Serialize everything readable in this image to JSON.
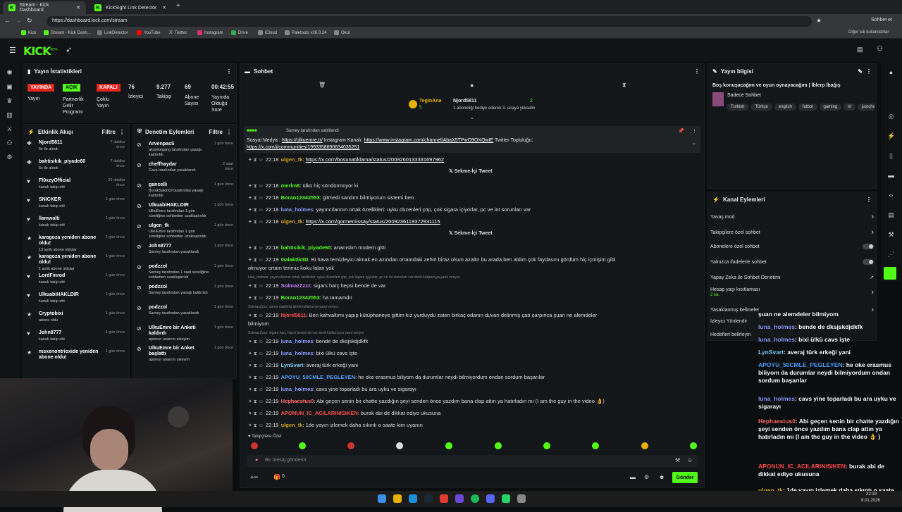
{
  "browser": {
    "tabs": [
      {
        "title": "Stream - Kick Dashboard"
      },
      {
        "title": "KickSight Link Detector"
      }
    ],
    "url": "https://dashboard.kick.com/stream",
    "profile": "Sohbet et",
    "bookmarks": [
      "Kick",
      "Stream - Kick Dash...",
      "LinkDetector",
      "YouTube",
      "Twitter",
      "Instagram",
      "Drive",
      "iCloud",
      "Paletools v26.0.24",
      "Okul"
    ],
    "other_bookmarks": "Diğer sık kullanılanlar"
  },
  "kick": {
    "logo": "KICK",
    "logo_sup": "BETA"
  },
  "stats": {
    "title": "Yayın İstatistikleri",
    "live_badge": "YAYINDA",
    "open_badge": "AÇIK",
    "closed_badge": "KAPALI",
    "live_label": "Yayın",
    "partner_label": "Partnerlik Gelir Programı",
    "multi_label": "Çoklu Yayın",
    "viewers": "76",
    "viewers_label": "İzleyici",
    "followers": "9.277",
    "followers_label": "Takipçi",
    "subs": "69",
    "subs_label": "Abone Sayısı",
    "uptime": "00:42:55",
    "uptime_label": "Yayında Olduğu Süre"
  },
  "activity": {
    "title": "Etkinlik Akışı",
    "filter": "Filtre",
    "items": [
      {
        "name": "Njord5811",
        "detail": "5x ile alındı",
        "time": "7 dakika önce",
        "icon": "✚"
      },
      {
        "name": "bahtisikik_piyade60",
        "detail": "5x ile alındı",
        "time": "7 dakika önce",
        "icon": "✚"
      },
      {
        "name": "Fl0xzyOfficial",
        "detail": "kanalı takip etti",
        "time": "29 dakika önce",
        "icon": "♥"
      },
      {
        "name": "SNICKER",
        "detail": "kanalı takip etti",
        "time": "1 gün önce",
        "icon": "♥"
      },
      {
        "name": "llamwalti",
        "detail": "kanalı takip etti",
        "time": "1 gün önce",
        "icon": "♥"
      },
      {
        "name": "karagoza yeniden abone oldu!",
        "detail": "13 aylık abone oldular",
        "time": "1 gün önce",
        "icon": "★"
      },
      {
        "name": "karagoza yeniden abone oldu!",
        "detail": "1 aylık abone oldular",
        "time": "1 gün önce",
        "icon": "★"
      },
      {
        "name": "LordFinrod",
        "detail": "kanalı takip etti",
        "time": "1 gün önce",
        "icon": "♥"
      },
      {
        "name": "UlkuabiHAKLDIR",
        "detail": "kanalı takip etti",
        "time": "1 gün önce",
        "icon": "♥"
      },
      {
        "name": "Cryptobixi",
        "detail": "abone oldu",
        "time": "1 gün önce",
        "icon": "★"
      },
      {
        "name": "John8777",
        "detail": "kanalı takip etti",
        "time": "1 gün önce",
        "icon": "♥"
      },
      {
        "name": "msxenontrioxide yeniden abone oldu!",
        "detail": "",
        "time": "1 gün önce",
        "icon": "★"
      }
    ]
  },
  "moderation": {
    "title": "Denetim Eylemleri",
    "filter": "Filtre",
    "items": [
      {
        "name": "ArvenpasS",
        "detail": "alosekegang tarafından yasağı kaldırıldı",
        "time": "1 gün önce"
      },
      {
        "name": "cheffhaydar",
        "detail": "Cavs tarafından yasaklandı",
        "time": "2 saat önce"
      },
      {
        "name": "gancelli",
        "detail": "BurakSakinOl tarafından yasağı kaldırıldı",
        "time": "1 gün önce"
      },
      {
        "name": "UlkuabiHAKLDIR",
        "detail": "UlkuEmre tarafından 1 gün süreliğine sohbetten uzaklaştırıldı",
        "time": "1 gün önce"
      },
      {
        "name": "ulgen_tk",
        "detail": "UlkuEmre tarafından 1 gün süreliğine sohbetten uzaklaştırıldı",
        "time": "1 gün önce"
      },
      {
        "name": "John8777",
        "detail": "Sarney tarafından yasaklandı",
        "time": "1 gün önce"
      },
      {
        "name": "podzzol",
        "detail": "Sarney tarafından 1 saat süreliğine sohbetten uzaklaştırıldı",
        "time": "1 gün önce"
      },
      {
        "name": "podzzol",
        "detail": "Sarney tarafından yasağı kaldırıldı",
        "time": "1 gün önce"
      },
      {
        "name": "podzzol",
        "detail": "Sarney tarafından yasaklandı",
        "time": "1 gün önce"
      },
      {
        "name": "UlkuEmre bir Anketi kaldırdı",
        "detail": "aponun ananını sikeyim",
        "time": "1 gün önce"
      },
      {
        "name": "UlkuEmre bir Anket başlattı",
        "detail": "aponun ananını sikeyim",
        "time": "1 gün önce"
      }
    ]
  },
  "chat": {
    "title": "Sohbet",
    "top_user1": "TeginAna",
    "top_user1_sub": "5",
    "top_user2": "Njord5811",
    "top_user2_count": "2",
    "gift_text": "1 aboneliği hediye ederek 3. sıraya yükselin",
    "pinned_by": "Sarney tarafından sabitlendi",
    "pinned_text_a": "Sosyal Medya : ",
    "pinned_link1": "https://ulkuemre.tr/",
    "pinned_text_b": " Instagram Kanalı: ",
    "pinned_link2": "https://www.instagram.com/channel/AbaX5TPwO9OXQwIE",
    "pinned_text_c": " Twitter Topluluğu:",
    "pinned_link3": "https://x.com/i/communities/1993358890634035251",
    "embed_label": "Sekme-İçi Tweet",
    "messages": [
      {
        "time": "22:18",
        "user": "ulgen_tk",
        "color": "#d4a017",
        "text": "",
        "link": "https://x.com/bosunatiklama/status/2009260133331697962"
      },
      {
        "time": "22:18",
        "user": "merlm8",
        "color": "#53fc18",
        "text": "ülkü hiç söndürmüyor ki",
        "link": ""
      },
      {
        "time": "22:18",
        "user": "Boran12342553",
        "color": "#53fc18",
        "text": "gitmedi sandım bilmiyorum sistemi ben",
        "link": ""
      },
      {
        "time": "22:18",
        "user": "luna_holmes",
        "color": "#8a9cff",
        "text": "yayıncılarının ortak özellikleri: uyku düzenleri çöp, çok sigara içiyorlar, pc ve int sorunları var",
        "link": ""
      },
      {
        "time": "22:18",
        "user": "ulgen_tk",
        "color": "#d4a017",
        "text": "",
        "link": "https://x.com/gormemissay/status/2009236119372931115"
      },
      {
        "time": "22:18",
        "user": "bahtisikik_piyade60",
        "color": "#53fc18",
        "text": "ananıskm modem gitti",
        "link": ""
      },
      {
        "time": "22:19",
        "user": "Galaktik3D",
        "color": "#53fc18",
        "text": "Bi hava temizleyici almak en azından ortamdaki zehiri biraz olsun azaltır bu arada ben aldım çok faydasını gördüm hiç içmişim gibi",
        "link": ""
      },
      {
        "time": "",
        "user": "",
        "color": "",
        "text": "olmuyor ortam terimiz koku falan yok",
        "link": ""
      },
      {
        "time": "22:19",
        "user": "SolmazZzzz",
        "color": "#c77dff",
        "text": "sigars harç hepsi bende de var",
        "link": ""
      },
      {
        "time": "22:19",
        "user": "Boran12342553",
        "color": "#53fc18",
        "text": "ha tamamdır",
        "link": ""
      },
      {
        "time": "22:19",
        "user": "Njord5811",
        "color": "#ff4d4d",
        "text": "Ben kahvaltımı yapıp kütüphaneye gittim kız yurduydu zaten birkaç odanın duvarı delinmiş çatı çarpınca şuan ne alemdeler",
        "link": ""
      },
      {
        "time": "",
        "user": "",
        "color": "",
        "text": "bilmiyom",
        "link": ""
      },
      {
        "time": "22:19",
        "user": "luna_holmes",
        "color": "#8a9cff",
        "text": "bende de dksjskdjdkfk",
        "link": ""
      },
      {
        "time": "22:19",
        "user": "luna_holmes",
        "color": "#8a9cff",
        "text": "bixi ülkü cavs işte",
        "link": ""
      },
      {
        "time": "22:19",
        "user": "LynSvart",
        "color": "#7fd3ff",
        "text": "averaj türk erkeği yani",
        "link": ""
      },
      {
        "time": "22:19",
        "user": "APOYU_50CMLE_PEGLEYEN",
        "color": "#4da3ff",
        "text": "he oke erasmus biliyom da durumlar neydi bilmiyordum ondan sordum başarılar",
        "link": ""
      },
      {
        "time": "22:19",
        "user": "luna_holmes",
        "color": "#8a9cff",
        "text": "cavs yine toparladı bu ara uyku ve sigarayı",
        "link": ""
      },
      {
        "time": "22:19",
        "user": "Hephaestus0",
        "color": "#ff6b6b",
        "text": "Abi geçen senin bir chatte yazdığın şeyi senden önce yazdım bana clap attın ya hatırladın mı (I am the guy in the video 👌)",
        "link": ""
      },
      {
        "time": "22:19",
        "user": "APONUN_IC_ACILARINISIKEN",
        "color": "#ff4d4d",
        "text": "burak abi de dikkat ediyo ukusuna",
        "link": ""
      },
      {
        "time": "22:19",
        "user": "ulgen_tk",
        "color": "#d4a017",
        "text": "1de yayın izlemek daha sıkıntı o saate kim uyanırı",
        "link": ""
      }
    ],
    "reply1": "luna_holmes: yayıncılarının ortak özellikleri: uyku düzenleri çöp, çok sigara içiyorlar, pc ve int sorunları var isimli kullanıcıya yanıt veriyor",
    "reply2": "SolmazZzzz: sonra napilmiş isimli kullanıcıya yanıt veriyor",
    "reply3": "SolmazZzzz: sigars harç hepsi bende de var isimli kullanıcıya yanıt veriyor",
    "followers_only": "Takipçilere Özel",
    "input_placeholder": "Bir mesaj gönderin",
    "points": "0",
    "send": "Gönder"
  },
  "stream_info": {
    "title_label": "Yayın bilgisi",
    "stream_title": "Boş konuşacağım ve oyun oynayacağım | İblerp İbağış",
    "category": "Sadece Sohbet",
    "tags": [
      "Turkish",
      "Türkçe",
      "english",
      "futbol",
      "gaming",
      "irl",
      "justchat"
    ]
  },
  "channel_actions": {
    "title": "Kanal Eylemleri",
    "items": [
      {
        "label": "Yavaş mod",
        "kind": "arrow"
      },
      {
        "label": "Takipçilere özel sohbet",
        "kind": "arrow"
      },
      {
        "label": "Abonelere özel sohbet",
        "kind": "toggle"
      },
      {
        "label": "Yalnızca ifadelerle sohbet",
        "kind": "toggle"
      },
      {
        "label": "Yapay Zeka ile Sohbet Denetimi",
        "kind": "ext"
      },
      {
        "label": "Hesap yaşı kısıtlaması",
        "kind": "arrow",
        "sub": "2 sa."
      },
      {
        "label": "Yasaklanmış kelimeler",
        "kind": "arrow"
      },
      {
        "label": "İzleyici Yönlendir",
        "kind": "none"
      },
      {
        "label": "Hedefleri belirleyin",
        "kind": "none"
      }
    ]
  },
  "overlay_chat": [
    {
      "user": "",
      "color": "#fff",
      "text": "şuan ne alemdeler bilmiyom"
    },
    {
      "user": "luna_holmes",
      "color": "#8a9cff",
      "text": ": bende de dksjskdjdkfk"
    },
    {
      "user": "luna_holmes",
      "color": "#8a9cff",
      "text": ": bixi ülkü cavs işte"
    },
    {
      "user": "LynSvart",
      "color": "#7fd3ff",
      "text": ": averaj türk erkeği yani"
    },
    {
      "user": "APOYU_50CMLE_PEGLEYEN",
      "color": "#4da3ff",
      "text": ": he oke erasmus biliyom da durumlar neydi bilmiyordum ondan sordum başarılar"
    },
    {
      "user": "luna_holmes",
      "color": "#8a9cff",
      "text": ": cavs yine toparladı bu ara uyku ve sigarayı"
    },
    {
      "user": "Hephaestus0",
      "color": "#ff6b6b",
      "text": ": Abi geçen senin bir chatte yazdığın şeyi senden önce yazdım bana clap attın ya hatırladın mı (I am the guy in the video 👌 )"
    },
    {
      "user": "APONUN_IC_ACILARINISIKEN",
      "color": "#ff4d4d",
      "text": ": burak abi de dikkat ediyo ukusuna"
    },
    {
      "user": "ulgen_tk",
      "color": "#d4a017",
      "text": ": 1de yayın izlemek daha sıkıntı o saate kim uyanırı"
    }
  ],
  "taskbar": {
    "time": "22:19",
    "date": "8.01.2026"
  }
}
